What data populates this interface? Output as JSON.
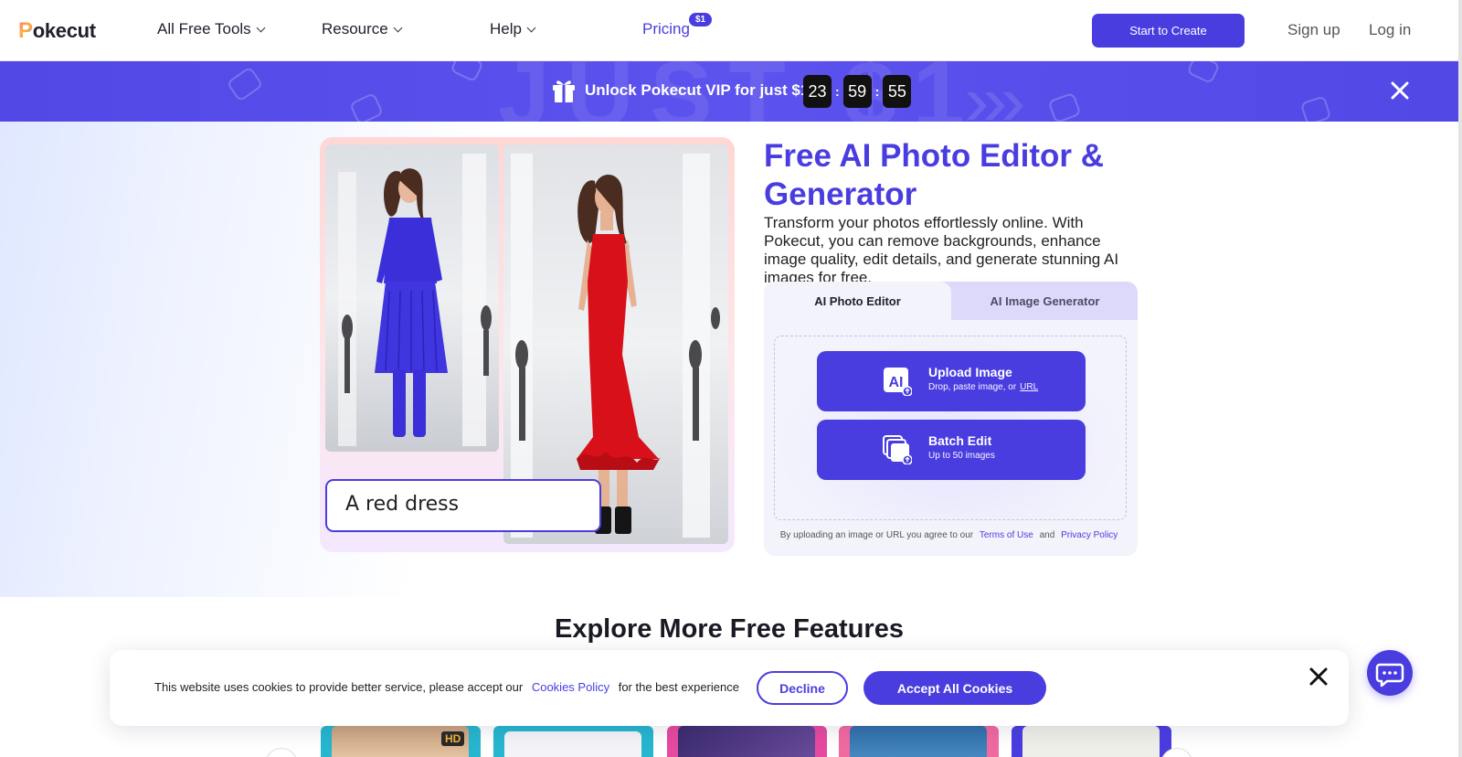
{
  "nav": {
    "logo": "okecut",
    "logo_initial": "P",
    "items": [
      {
        "label": "All Free Tools"
      },
      {
        "label": "Resource"
      },
      {
        "label": "Help"
      }
    ],
    "pricing": "Pricing",
    "pricing_badge": "$1",
    "start_button": "Start to Create",
    "signup": "Sign up",
    "login": "Log in"
  },
  "promo": {
    "bg_text": "JUST $1",
    "text": "Unlock Pokecut VIP for just $1",
    "hours": "23",
    "minutes": "59",
    "seconds": "55",
    "separator": ":"
  },
  "hero": {
    "title": "Free AI Photo Editor & Generator",
    "subtitle": "Transform your photos effortlessly online. With Pokecut, you can remove backgrounds, enhance image quality, edit details, and generate stunning AI images for free.",
    "prompt": "A red dress",
    "tabs": [
      {
        "label": "AI Photo Editor",
        "active": true
      },
      {
        "label": "AI Image Generator",
        "active": false
      }
    ],
    "upload": {
      "title": "Upload Image",
      "desc": "Drop, paste image, or",
      "url": "URL"
    },
    "batch": {
      "title": "Batch Edit",
      "desc": "Up to 50 images"
    },
    "legal": {
      "prefix": "By uploading an image or URL you agree to our",
      "terms": "Terms of Use",
      "and": "and",
      "privacy": "Privacy Policy"
    }
  },
  "explore": {
    "title": "Explore More Free Features",
    "hd_badge": "HD"
  },
  "cookie": {
    "text": "This website uses cookies to provide better service, please accept our",
    "link": "Cookies Policy",
    "suffix": "for the best experience",
    "decline": "Decline",
    "accept": "Accept All Cookies"
  },
  "colors": {
    "brand": "#4a3de0",
    "dress_red": "#d8101a",
    "timer_bg": "#111111"
  }
}
